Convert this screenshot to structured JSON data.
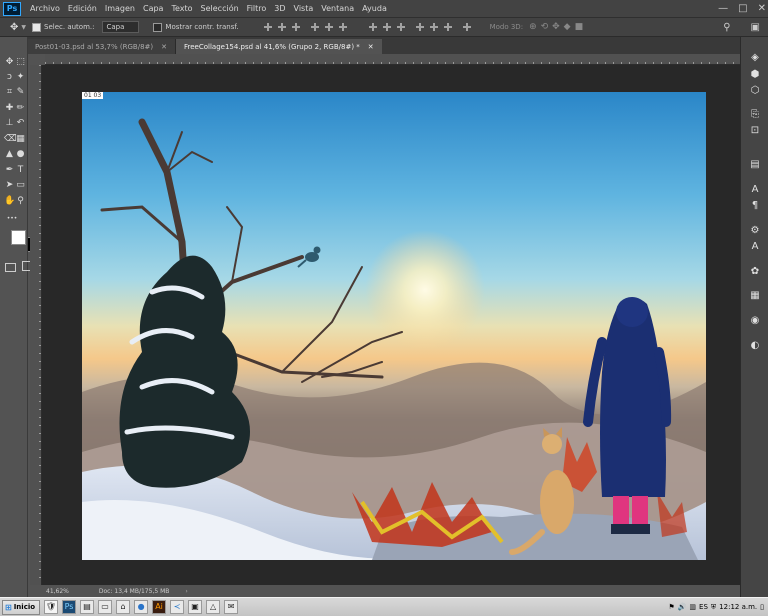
{
  "app": {
    "logo": "Ps"
  },
  "menu": [
    "Archivo",
    "Edición",
    "Imagen",
    "Capa",
    "Texto",
    "Selección",
    "Filtro",
    "3D",
    "Vista",
    "Ventana",
    "Ayuda"
  ],
  "window_controls": {
    "minimize": "—",
    "maximize": "□",
    "close": "✕"
  },
  "options": {
    "auto_select_label": "Selec. autom.:",
    "auto_select_value": "Capa",
    "show_transform_label": "Mostrar contr. transf.",
    "mode_3d_label": "Modo 3D:"
  },
  "tabs": [
    {
      "label": "Post01-03.psd al 53,7% (RGB/8#)",
      "active": false
    },
    {
      "label": "FreeCollage154.psd al 41,6% (Grupo 2, RGB/8#) *",
      "active": true
    }
  ],
  "canvas": {
    "layer_label": "01 03"
  },
  "status": {
    "zoom": "41,62%",
    "doc": "Doc: 13,4 MB/175,5 MB"
  },
  "taskbar": {
    "start_label": "Inicio",
    "clock": "12:12 a.m."
  },
  "icons": {
    "move": "✥",
    "marquee": "⬚",
    "lasso": "ↄ",
    "wand": "✦",
    "crop": "⌗",
    "eyedropper": "✎",
    "heal": "✚",
    "brush": "✏",
    "stamp": "⊥",
    "history": "↶",
    "eraser": "⌫",
    "gradient": "▦",
    "blur": "▲",
    "dodge": "●",
    "pen": "✒",
    "type": "T",
    "path": "➤",
    "shape": "▭",
    "hand": "✋",
    "zoom": "⚲",
    "more": "•••"
  }
}
